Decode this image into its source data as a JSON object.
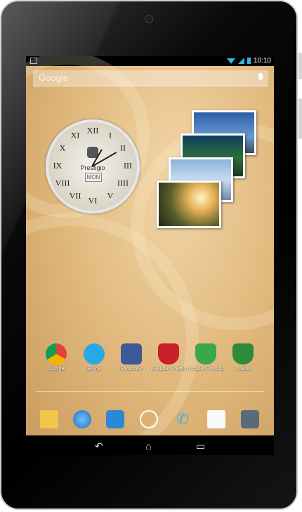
{
  "status_bar": {
    "time": "10:10"
  },
  "search": {
    "label": "Google"
  },
  "clock": {
    "brand": "Prestigio",
    "day": "MON",
    "numerals": [
      "XII",
      "I",
      "II",
      "III",
      "IIII",
      "V",
      "VI",
      "VII",
      "VIII",
      "IX",
      "X",
      "XI"
    ]
  },
  "apps": [
    {
      "label": "Google",
      "color": "#4a8af4"
    },
    {
      "label": "Skype",
      "color": "#2aa7e6"
    },
    {
      "label": "Facebook",
      "color": "#3b5998"
    },
    {
      "label": "eReader Prestig",
      "color": "#c8202a"
    },
    {
      "label": "Installer Prestigio",
      "color": "#3aa84a"
    },
    {
      "label": "Navitel",
      "color": "#2e8b3a"
    }
  ],
  "dock": [
    "email-icon",
    "browser-icon",
    "file-manager-icon",
    "app-drawer-icon",
    "phone-icon",
    "play-store-icon",
    "camera-icon"
  ],
  "accent_color": "#33b5e5"
}
